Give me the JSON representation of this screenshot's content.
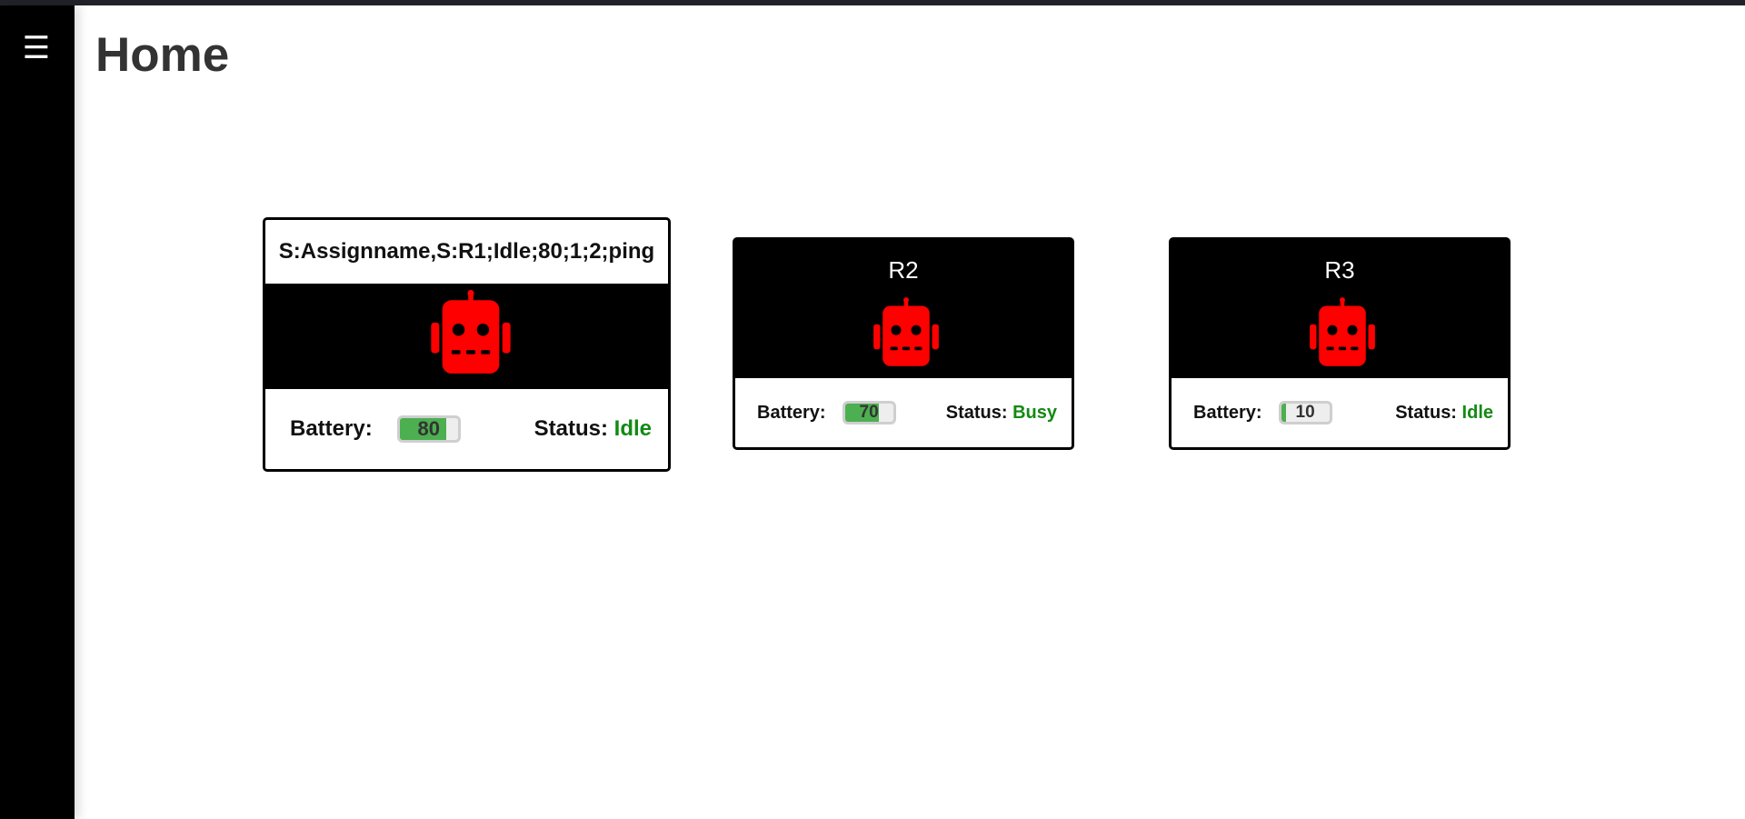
{
  "page": {
    "title": "Home"
  },
  "menu": {
    "icon_glyph": "☰",
    "icon": "hamburger-menu-icon"
  },
  "colors": {
    "sidebar": "#000000",
    "card": "#000000",
    "robot": "#ff0000",
    "battery_fill": "#4caf50",
    "status_text": "#128a12"
  },
  "robots": [
    {
      "name": "S:Assignname,S:R1;Idle;80;1;2;ping",
      "battery_label": "Battery:",
      "battery": 80,
      "battery_text": "80",
      "status_label": "Status:",
      "status": "Idle",
      "icon": "robot-icon"
    },
    {
      "name": "R2",
      "battery_label": "Battery:",
      "battery": 70,
      "battery_text": "70",
      "status_label": "Status:",
      "status": "Busy",
      "icon": "robot-icon"
    },
    {
      "name": "R3",
      "battery_label": "Battery:",
      "battery": 10,
      "battery_text": "10",
      "status_label": "Status:",
      "status": "Idle",
      "icon": "robot-icon"
    }
  ]
}
